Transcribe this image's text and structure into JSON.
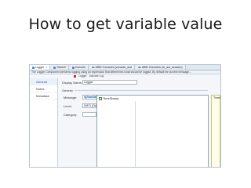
{
  "slide": {
    "title": "How to get variable value"
  },
  "tabs": [
    {
      "label": "Logger",
      "active": true
    },
    {
      "label": "Search"
    },
    {
      "label": "Console"
    },
    {
      "label": "as dfNS Consoles (console_asd"
    },
    {
      "label": "as dfNS Consoles (re_asr_session)"
    }
  ],
  "infobar": {
    "text": "The Logger Component performs logging using an expression that determines what should be logged. By default the current message..."
  },
  "subbar": {
    "item1": "Logger",
    "item2": "Activate Log"
  },
  "leftnav": {
    "items": [
      "General",
      "Notes",
      "Metadata"
    ]
  },
  "form": {
    "display_name_label": "Display Name:",
    "display_name_value": "Logger",
    "generic_label": "Generic",
    "message_label": "Message:",
    "message_value": "#[flowVars",
    "level_label": "Level:",
    "level_value": "INFO (Defa",
    "category_label": "Category:"
  },
  "autocomplete": {
    "item": "TimeStamp"
  },
  "tooltip": {
    "text": "TimeStamp"
  }
}
